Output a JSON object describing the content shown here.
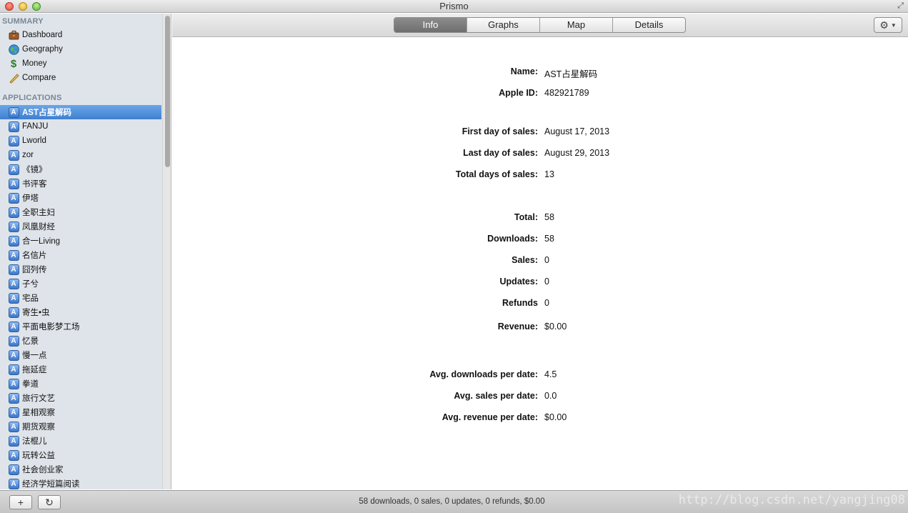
{
  "window": {
    "title": "Prismo"
  },
  "sidebar": {
    "summary_header": "SUMMARY",
    "summary_items": [
      {
        "label": "Dashboard",
        "icon": "briefcase-icon"
      },
      {
        "label": "Geography",
        "icon": "globe-icon"
      },
      {
        "label": "Money",
        "icon": "dollar-icon"
      },
      {
        "label": "Compare",
        "icon": "ruler-icon"
      }
    ],
    "applications_header": "APPLICATIONS",
    "applications": [
      "AST占星解码",
      "FANJU",
      "Lworld",
      "zor",
      "《镜》",
      "书评客",
      "伊塔",
      "全职主妇",
      "凤凰财经",
      "合一Living",
      "名信片",
      "囧列传",
      "子兮",
      "宅品",
      "寄生•虫",
      "平面电影梦工场",
      "忆景",
      "慢一点",
      "拖延症",
      "拳道",
      "旅行文艺",
      "星相观察",
      "期货观察",
      "法棍儿",
      "玩转公益",
      "社会创业家",
      "经济学短篇阅读"
    ],
    "selected_index": 0
  },
  "toolbar": {
    "tabs": [
      "Info",
      "Graphs",
      "Map",
      "Details"
    ],
    "active_tab": "Info",
    "gear_icon": "gear-icon"
  },
  "info": {
    "name_label": "Name:",
    "name": "AST占星解码",
    "apple_id_label": "Apple ID:",
    "apple_id": "482921789",
    "first_day_label": "First day of sales:",
    "first_day": "August 17, 2013",
    "last_day_label": "Last day of sales:",
    "last_day": "August 29, 2013",
    "total_days_label": "Total days of sales:",
    "total_days": "13",
    "total_label": "Total:",
    "total": "58",
    "downloads_label": "Downloads:",
    "downloads": "58",
    "sales_label": "Sales:",
    "sales": "0",
    "updates_label": "Updates:",
    "updates": "0",
    "refunds_label": "Refunds",
    "refunds": "0",
    "revenue_label": "Revenue:",
    "revenue": "$0.00",
    "avg_downloads_label": "Avg. downloads per date:",
    "avg_downloads": "4.5",
    "avg_sales_label": "Avg. sales per date:",
    "avg_sales": "0.0",
    "avg_revenue_label": "Avg. revenue per date:",
    "avg_revenue": "$0.00"
  },
  "statusbar": {
    "add_label": "+",
    "refresh_label": "↻",
    "text": "58 downloads, 0 sales, 0 updates, 0 refunds, $0.00",
    "watermark": "http://blog.csdn.net/yangjing08"
  }
}
